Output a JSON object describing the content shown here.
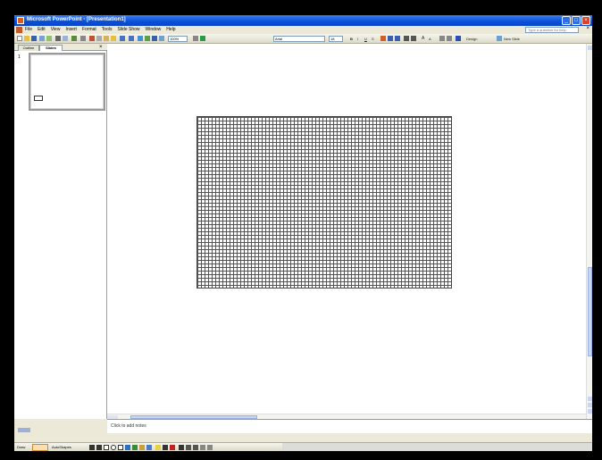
{
  "window": {
    "title": "Microsoft PowerPoint - [Presentation1]",
    "controls": [
      "minimize",
      "maximize",
      "close"
    ]
  },
  "menubar": {
    "items": [
      "File",
      "Edit",
      "View",
      "Insert",
      "Format",
      "Tools",
      "Slide Show",
      "Window",
      "Help"
    ],
    "help_placeholder": "Type a question for help"
  },
  "toolbar": {
    "zoom": "100%",
    "font_name": "Arial",
    "font_size": "18",
    "design_label": "Design",
    "new_slide_label": "New Slide"
  },
  "left_pane": {
    "tabs": [
      "Outline",
      "Slides"
    ],
    "active_tab": "Slides",
    "slide_number": "1"
  },
  "notes": {
    "placeholder": "Click to add notes"
  },
  "drawing_toolbar": {
    "draw_label": "Draw",
    "autoshapes_label": "AutoShapes"
  },
  "colors": {
    "title_bar": "#0a4fd8",
    "workspace": "#ffffff",
    "chrome": "#ece9d8",
    "grid_line": "#555555"
  }
}
